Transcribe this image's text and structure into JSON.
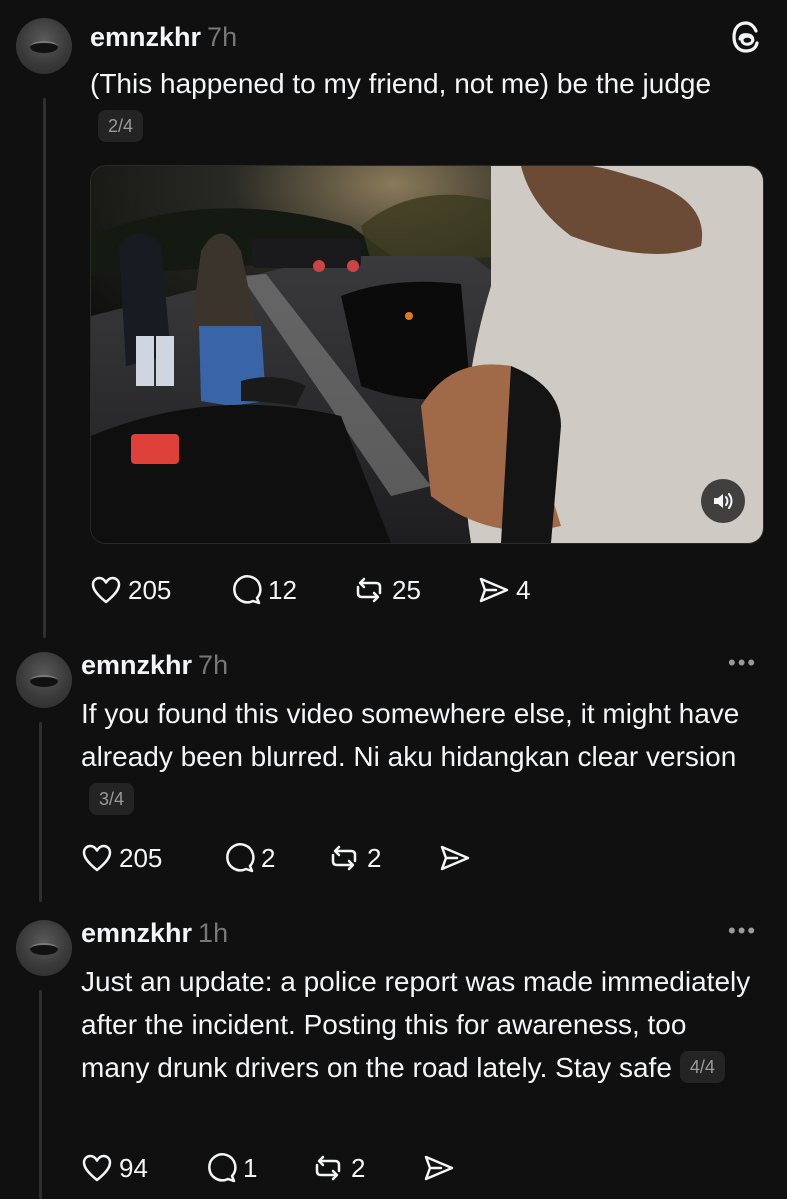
{
  "app": {
    "logo_icon": "threads-logo-icon"
  },
  "posts": [
    {
      "username": "emnzkhr",
      "time": "7h",
      "text": "(This happened to my friend, not me) be the judge",
      "counter": "2/4",
      "media": {
        "type": "video",
        "sound_icon": "volume-icon"
      },
      "likes": "205",
      "replies": "12",
      "reposts": "25",
      "shares": "4"
    },
    {
      "username": "emnzkhr",
      "time": "7h",
      "text": "If you found this video somewhere else, it might have already been blurred. Ni aku hidangkan clear version",
      "counter": "3/4",
      "likes": "205",
      "replies": "2",
      "reposts": "2",
      "shares": ""
    },
    {
      "username": "emnzkhr",
      "time": "1h",
      "text": "Just an update: a police report was made immediately after the incident. Posting this for awareness, too many drunk drivers on the road lately. Stay safe",
      "counter": "4/4",
      "likes": "94",
      "replies": "1",
      "reposts": "2",
      "shares": ""
    }
  ],
  "icons": {
    "like": "heart-icon",
    "reply": "comment-icon",
    "repost": "repost-icon",
    "share": "send-icon",
    "more": "more-options-icon"
  },
  "more_label": "•••"
}
